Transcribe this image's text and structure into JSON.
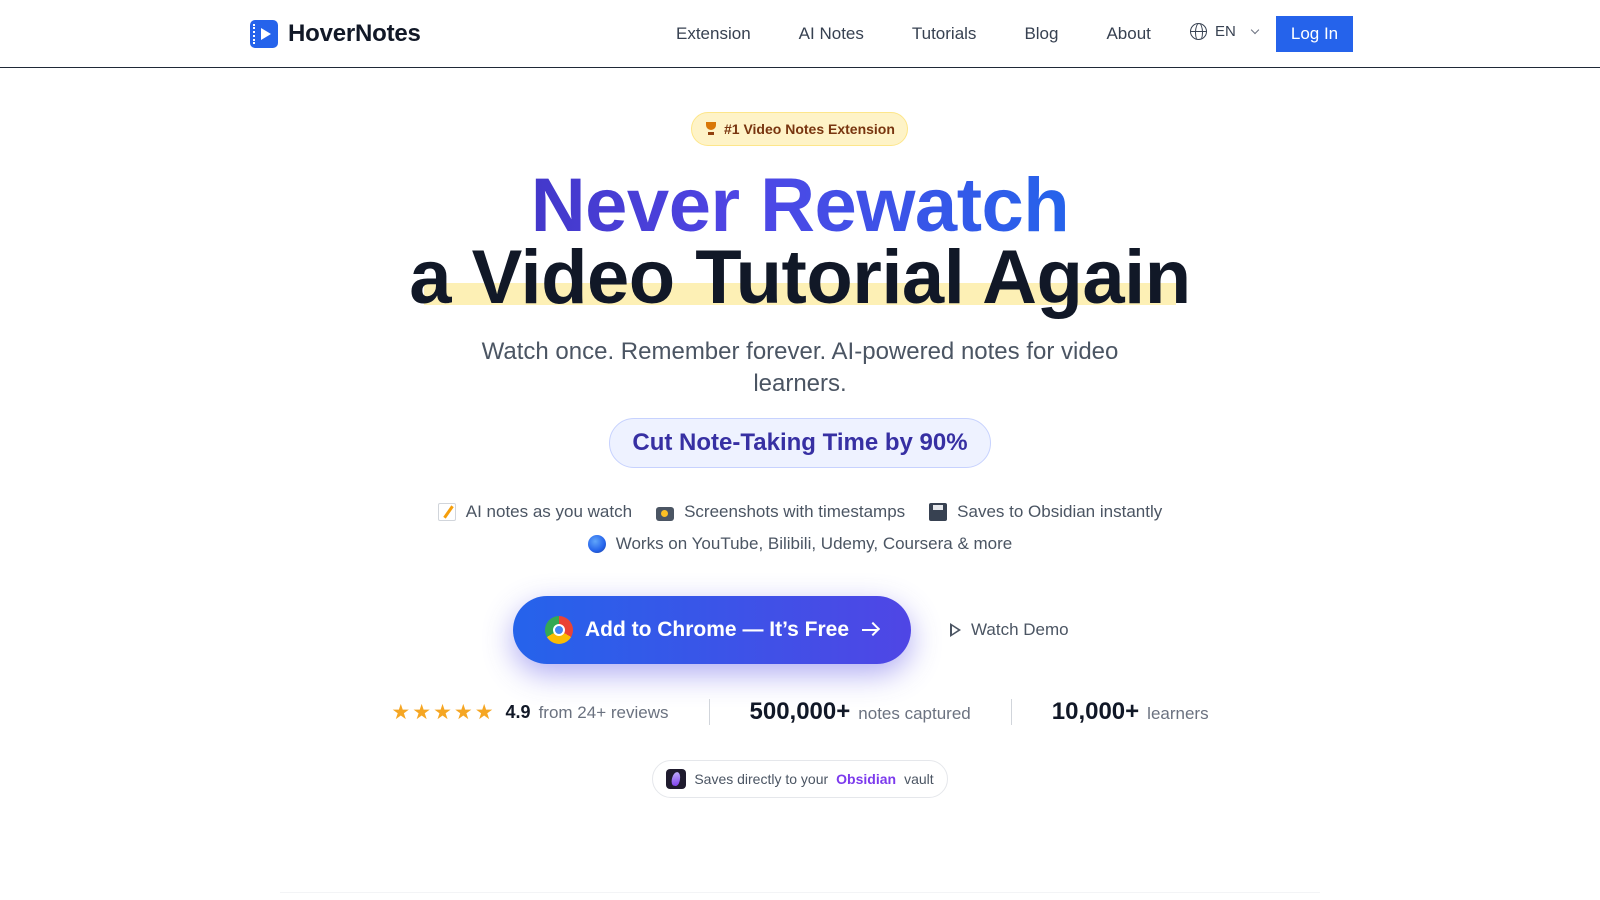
{
  "brand": {
    "name": "HoverNotes",
    "accent": "#2563eb"
  },
  "nav": {
    "items": [
      "Extension",
      "AI Notes",
      "Tutorials",
      "Blog",
      "About"
    ],
    "language": "EN",
    "login_label": "Log In"
  },
  "hero": {
    "badge": "#1 Video Notes Extension",
    "headline_line1": "Never Rewatch",
    "headline_line2": "a Video Tutorial Again",
    "subtitle": "Watch once. Remember forever. AI-powered notes for video learners.",
    "pill": "Cut Note-Taking Time by 90%",
    "features": [
      {
        "icon": "memo-icon",
        "text": "AI notes as you watch"
      },
      {
        "icon": "camera-icon",
        "text": "Screenshots with timestamps"
      },
      {
        "icon": "floppy-disk-icon",
        "text": "Saves to Obsidian instantly"
      },
      {
        "icon": "globe-icon",
        "text": "Works on YouTube, Bilibili, Udemy, Coursera & more"
      }
    ],
    "cta_label": "Add to Chrome — It’s Free",
    "demo_label": "Watch Demo"
  },
  "stats": {
    "rating": "4.9",
    "stars": 5,
    "reviews_text": "from 24+ reviews",
    "notes_value": "500,000+",
    "notes_label": "notes captured",
    "learners_value": "10,000+",
    "learners_label": "learners"
  },
  "obsidian_note": {
    "prefix": "Saves directly to your",
    "brand": "Obsidian",
    "suffix": "vault"
  }
}
